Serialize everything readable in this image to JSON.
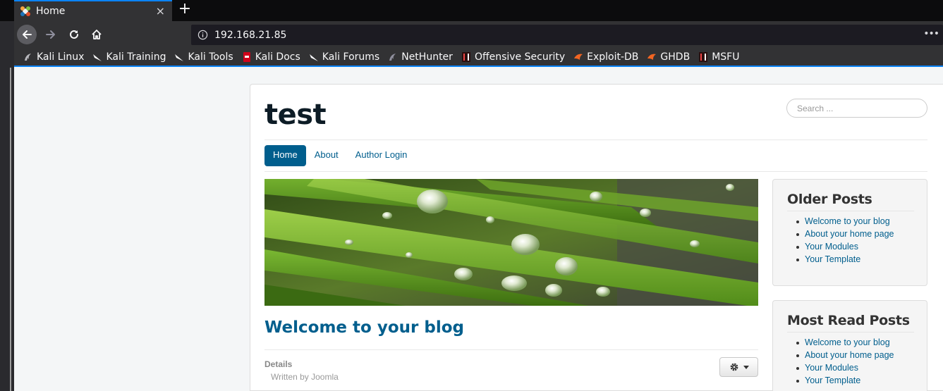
{
  "browser": {
    "tab": {
      "title": "Home",
      "close": "×"
    },
    "new_tab": "+",
    "url": "192.168.21.85",
    "more": "•••",
    "bookmarks": [
      {
        "label": "Kali Linux",
        "icon": "kali-dragon-icon"
      },
      {
        "label": "Kali Training",
        "icon": "kali-dragon-icon"
      },
      {
        "label": "Kali Tools",
        "icon": "kali-dragon-icon"
      },
      {
        "label": "Kali Docs",
        "icon": "kali-docs-icon"
      },
      {
        "label": "Kali Forums",
        "icon": "kali-dragon-icon"
      },
      {
        "label": "NetHunter",
        "icon": "nethunter-icon"
      },
      {
        "label": "Offensive Security",
        "icon": "offsec-icon"
      },
      {
        "label": "Exploit-DB",
        "icon": "exploit-db-icon"
      },
      {
        "label": "GHDB",
        "icon": "ghdb-icon"
      },
      {
        "label": "MSFU",
        "icon": "msfu-icon"
      }
    ]
  },
  "site": {
    "title": "test",
    "search_placeholder": "Search ...",
    "nav": [
      {
        "label": "Home",
        "active": true
      },
      {
        "label": "About",
        "active": false
      },
      {
        "label": "Author Login",
        "active": false
      }
    ]
  },
  "article": {
    "title": "Welcome to your blog",
    "details_label": "Details",
    "author": "Written by Joomla"
  },
  "modules": {
    "older_posts": {
      "title": "Older Posts",
      "items": [
        "Welcome to your blog",
        "About your home page",
        "Your Modules",
        "Your Template"
      ]
    },
    "most_read": {
      "title": "Most Read Posts",
      "items": [
        "Welcome to your blog",
        "About your home page",
        "Your Modules",
        "Your Template"
      ]
    }
  },
  "colors": {
    "accent": "#005e8d",
    "browser_dark": "#323234",
    "tab_highlight": "#0a84ff"
  }
}
